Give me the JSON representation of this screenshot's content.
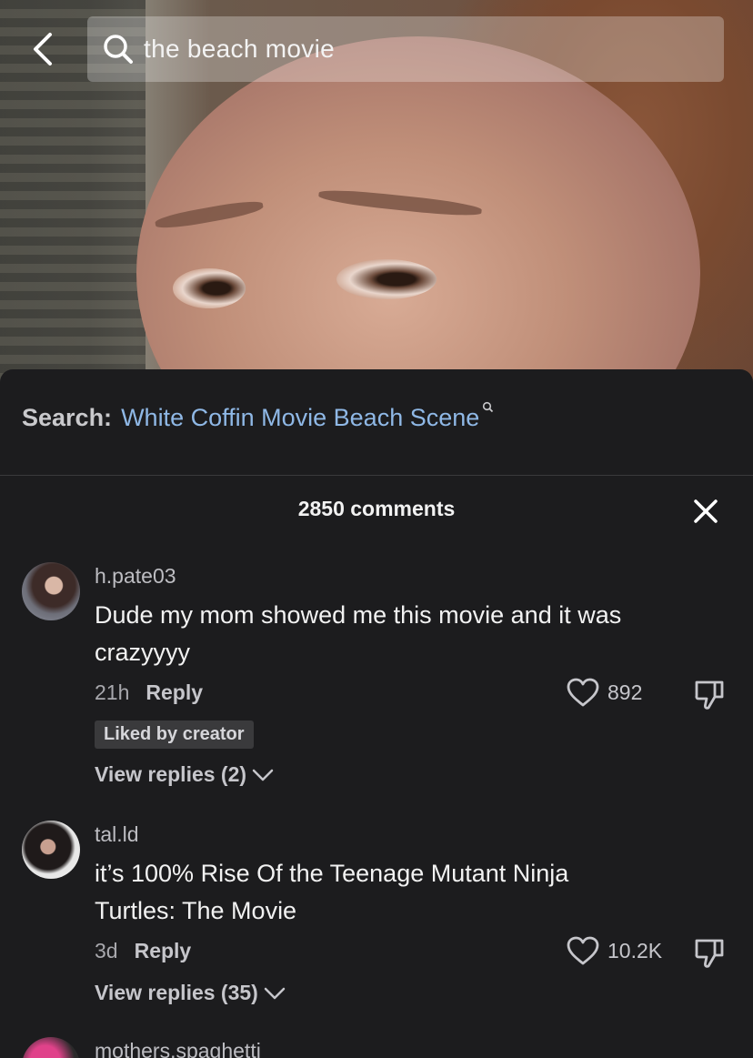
{
  "search": {
    "query": "the beach movie"
  },
  "suggestion": {
    "label": "Search:",
    "term": "White Coffin Movie Beach Scene"
  },
  "comments_header": {
    "count_label": "2850 comments"
  },
  "comments": [
    {
      "username": "h.pate03",
      "text": "Dude my mom showed me this movie and it was crazyyyy",
      "time": "21h",
      "reply_label": "Reply",
      "likes": "892",
      "badge": "Liked by creator",
      "view_replies": "View replies (2)"
    },
    {
      "username": "tal.ld",
      "text": "it’s 100% Rise Of the Teenage Mutant Ninja Turtles: The Movie",
      "time": "3d",
      "reply_label": "Reply",
      "likes": "10.2K",
      "view_replies": "View replies (35)"
    },
    {
      "username": "mothers.spaghetti"
    }
  ],
  "colors": {
    "link": "#8fb8e6",
    "panel": "#1c1c1e",
    "badge_bg": "#3a3a3c"
  }
}
